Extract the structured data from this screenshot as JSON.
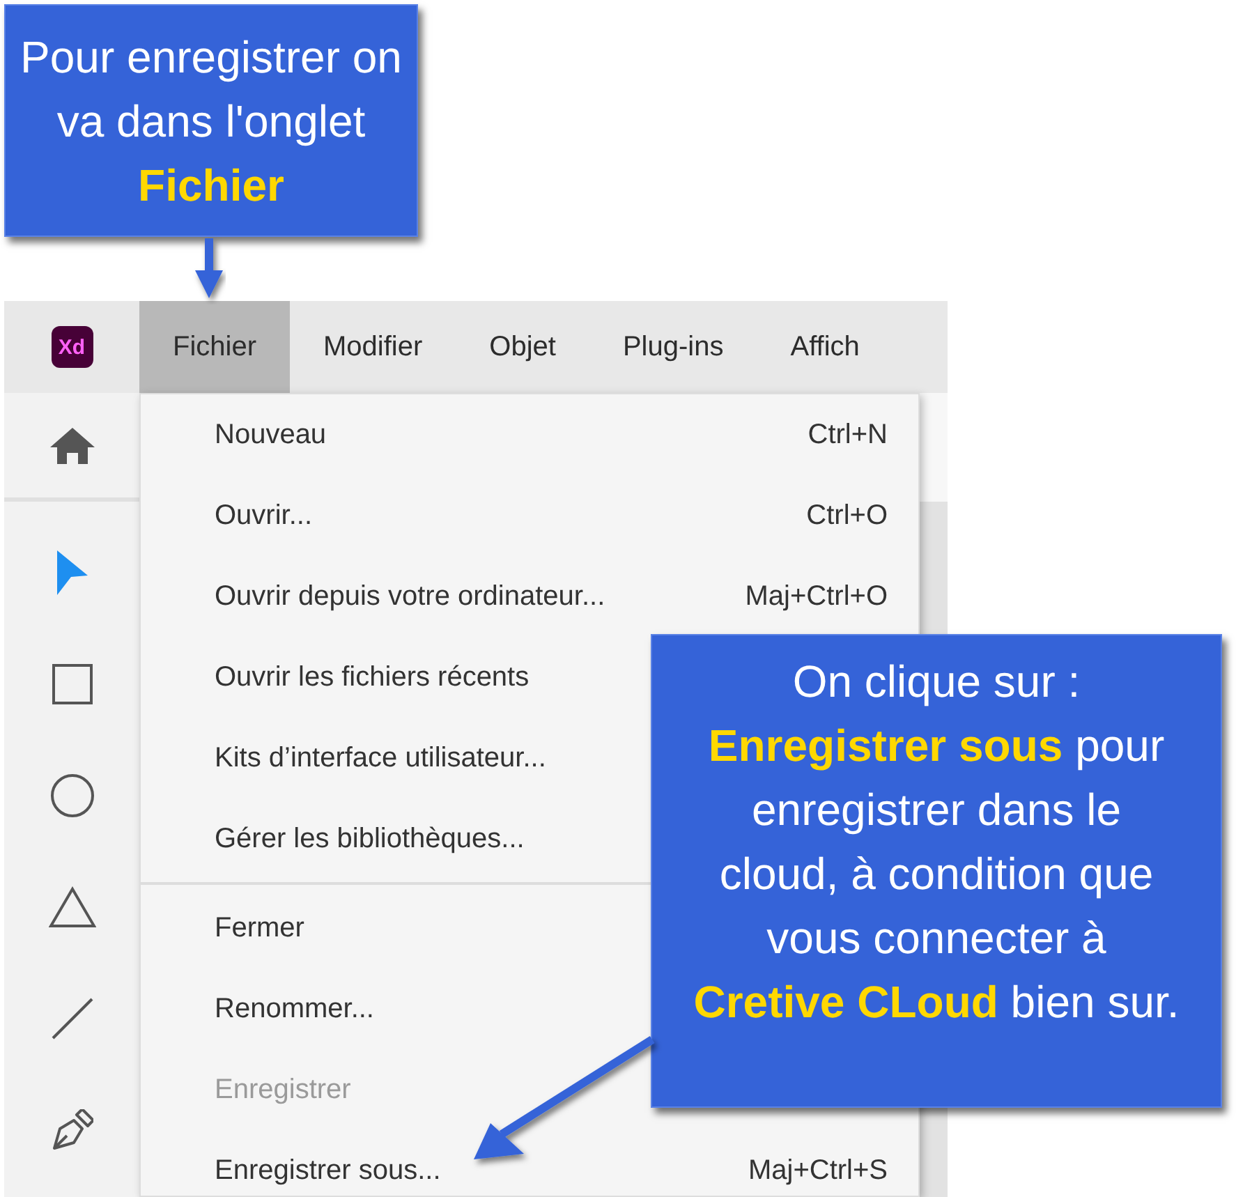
{
  "callouts": [
    {
      "text": "Pour enregistrer on va dans l'onglet **Fichier**"
    },
    {
      "text": "On clique sur : **Enregistrer sous** pour enregistrer dans le cloud, à condition que vous connecter à **Cretive CLoud** bien sur."
    }
  ],
  "app": {
    "logo": "Xd",
    "menubar": [
      {
        "label": "Fichier",
        "selected": true
      },
      {
        "label": "Modifier",
        "selected": false
      },
      {
        "label": "Objet",
        "selected": false
      },
      {
        "label": "Plug-ins",
        "selected": false
      },
      {
        "label": "Affich",
        "selected": false
      }
    ],
    "toolbar": [
      {
        "kind": "home",
        "selected": false
      },
      {
        "kind": "select",
        "selected": true
      },
      {
        "kind": "rectangle",
        "selected": false
      },
      {
        "kind": "ellipse",
        "selected": false
      },
      {
        "kind": "triangle",
        "selected": false
      },
      {
        "kind": "line",
        "selected": false
      },
      {
        "kind": "pen",
        "selected": false
      }
    ],
    "file_menu": {
      "groups": [
        [
          {
            "label": "Nouveau",
            "shortcut": "Ctrl+N",
            "disabled": false
          },
          {
            "label": "Ouvrir...",
            "shortcut": "Ctrl+O",
            "disabled": false
          },
          {
            "label": "Ouvrir depuis votre ordinateur...",
            "shortcut": "Maj+Ctrl+O",
            "disabled": false
          },
          {
            "label": "Ouvrir les fichiers récents",
            "disabled": false
          },
          {
            "label": "Kits d’interface utilisateur...",
            "disabled": false
          },
          {
            "label": "Gérer les bibliothèques...",
            "disabled": false
          }
        ],
        [
          {
            "label": "Fermer",
            "disabled": false
          },
          {
            "label": "Renommer...",
            "disabled": false
          },
          {
            "label": "Enregistrer",
            "disabled": true
          },
          {
            "label": "Enregistrer sous...",
            "shortcut": "Maj+Ctrl+S",
            "disabled": false
          }
        ]
      ]
    }
  }
}
